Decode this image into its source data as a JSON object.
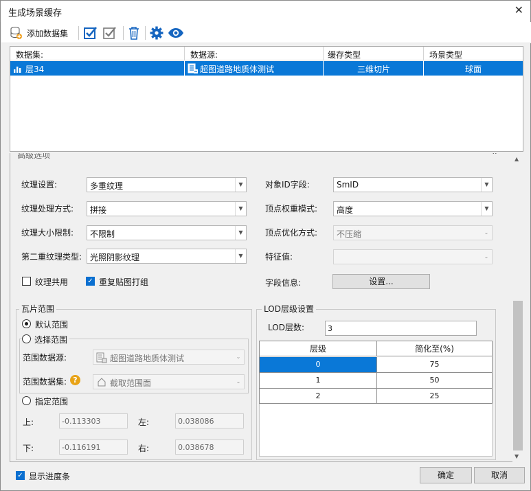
{
  "window": {
    "title": "生成场景缓存",
    "close_glyph": "✕"
  },
  "toolbar": {
    "add_dataset_label": "添加数据集"
  },
  "grid": {
    "headers": [
      "数据集:",
      "数据源:",
      "缓存类型",
      "场景类型"
    ],
    "rows": [
      {
        "dataset": "层34",
        "datasource": "超图道路地质体测试",
        "cache_type": "三维切片",
        "scene_type": "球面"
      }
    ]
  },
  "advanced": {
    "title": "高级选项",
    "collapse_glyph": "⌃",
    "texture_setting_label": "纹理设置:",
    "texture_setting_value": "多重纹理",
    "texture_process_label": "纹理处理方式:",
    "texture_process_value": "拼接",
    "texture_size_label": "纹理大小限制:",
    "texture_size_value": "不限制",
    "second_texture_label": "第二重纹理类型:",
    "second_texture_value": "光照阴影纹理",
    "object_id_label": "对象ID字段:",
    "object_id_value": "SmID",
    "vertex_weight_label": "顶点权重模式:",
    "vertex_weight_value": "高度",
    "vertex_optimize_label": "顶点优化方式:",
    "vertex_optimize_value": "不压缩",
    "feature_label": "特征值:",
    "feature_value": "",
    "texture_share_label": "纹理共用",
    "texture_share_checked": false,
    "repeat_tile_label": "重复贴图打组",
    "repeat_tile_checked": true,
    "field_info_label": "字段信息:",
    "settings_button": "设置..."
  },
  "tile_range": {
    "title": "瓦片范围",
    "default_range": "默认范围",
    "select_range": "选择范围",
    "range_datasource_label": "范围数据源:",
    "range_datasource_value": "超图道路地质体测试",
    "range_dataset_label": "范围数据集:",
    "range_dataset_value": "截取范围面",
    "specify_range": "指定范围",
    "selected": "default",
    "top_label": "上:",
    "top_value": "-0.113303",
    "left_label": "左:",
    "left_value": "0.038086",
    "bottom_label": "下:",
    "bottom_value": "-0.116191",
    "right_label": "右:",
    "right_value": "0.038678"
  },
  "lod": {
    "title": "LOD层级设置",
    "count_label": "LOD层数:",
    "count_value": "3",
    "headers": [
      "层级",
      "简化至(%)"
    ],
    "rows": [
      {
        "level": "0",
        "simplify": "75"
      },
      {
        "level": "1",
        "simplify": "50"
      },
      {
        "level": "2",
        "simplify": "25"
      }
    ]
  },
  "footer": {
    "show_progress_label": "显示进度条",
    "show_progress_checked": true,
    "ok_button": "确定",
    "cancel_button": "取消"
  },
  "colors": {
    "selection": "#0a78d7",
    "icon_blue": "#1565c0"
  }
}
